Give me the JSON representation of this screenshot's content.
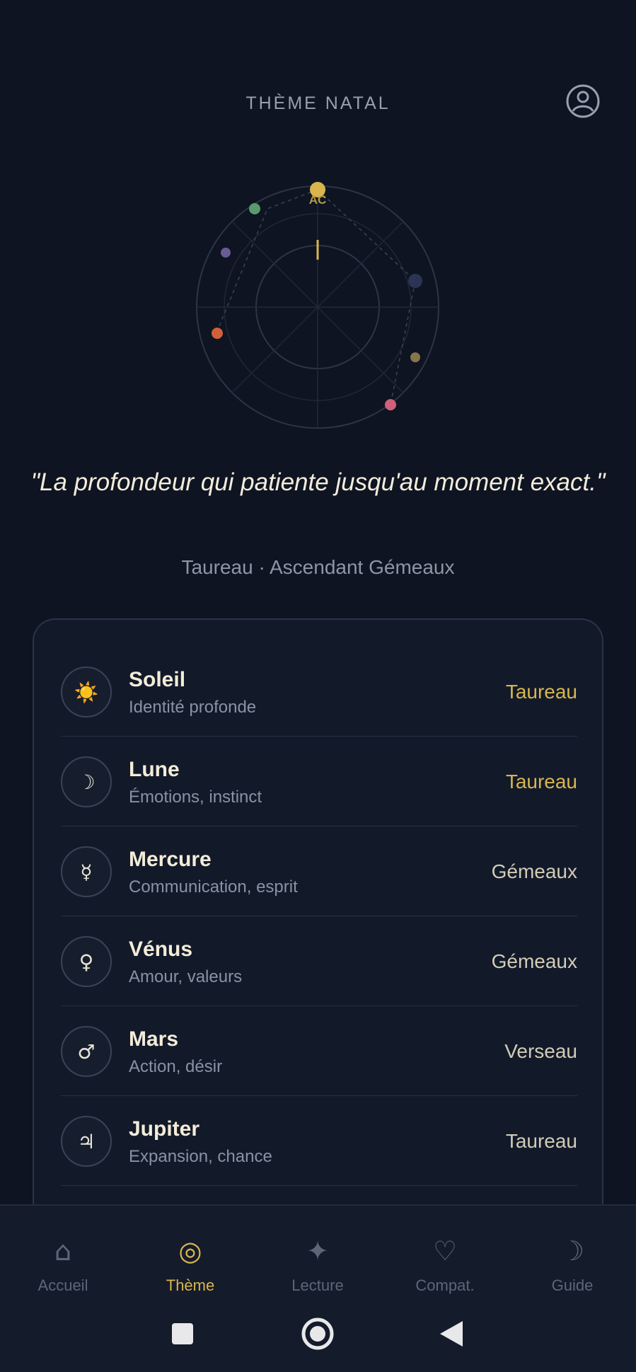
{
  "header": {
    "title": "THÈME NATAL",
    "profile_icon": "user-circle-icon"
  },
  "chart": {
    "ascendant_label": "AC"
  },
  "quote": "\"La profondeur qui patiente jusqu'au moment exact.\"",
  "sign_line": "Taureau · Ascendant Gémeaux",
  "colors": {
    "accent": "#d9b54f",
    "background": "#0e1421",
    "card": "#121a2a"
  },
  "planets": [
    {
      "icon": "☀️",
      "icon_name": "sun-icon",
      "name": "Soleil",
      "desc": "Identité profonde",
      "sign": "Taureau",
      "sign_color": "#d9b54f"
    },
    {
      "icon": "☽",
      "icon_name": "moon-icon",
      "name": "Lune",
      "desc": "Émotions, instinct",
      "sign": "Taureau",
      "sign_color": "#d9b54f"
    },
    {
      "icon": "☿",
      "icon_name": "mercury-icon",
      "name": "Mercure",
      "desc": "Communication, esprit",
      "sign": "Gémeaux",
      "sign_color": "#d3cbb6"
    },
    {
      "icon": "♀",
      "icon_name": "venus-icon",
      "name": "Vénus",
      "desc": "Amour, valeurs",
      "sign": "Gémeaux",
      "sign_color": "#d3cbb6"
    },
    {
      "icon": "♂",
      "icon_name": "mars-icon",
      "name": "Mars",
      "desc": "Action, désir",
      "sign": "Verseau",
      "sign_color": "#d3cbb6"
    },
    {
      "icon": "♃",
      "icon_name": "jupiter-icon",
      "name": "Jupiter",
      "desc": "Expansion, chance",
      "sign": "Taureau",
      "sign_color": "#d3cbb6"
    }
  ],
  "nav": [
    {
      "label": "Accueil",
      "icon": "⌂",
      "icon_name": "home-icon",
      "active": false
    },
    {
      "label": "Thème",
      "icon": "◎",
      "icon_name": "target-icon",
      "active": true
    },
    {
      "label": "Lecture",
      "icon": "✦",
      "icon_name": "sparkle-icon",
      "active": false
    },
    {
      "label": "Compat.",
      "icon": "♡",
      "icon_name": "heart-icon",
      "active": false
    },
    {
      "label": "Guide",
      "icon": "☽",
      "icon_name": "moon-icon",
      "active": false
    }
  ]
}
